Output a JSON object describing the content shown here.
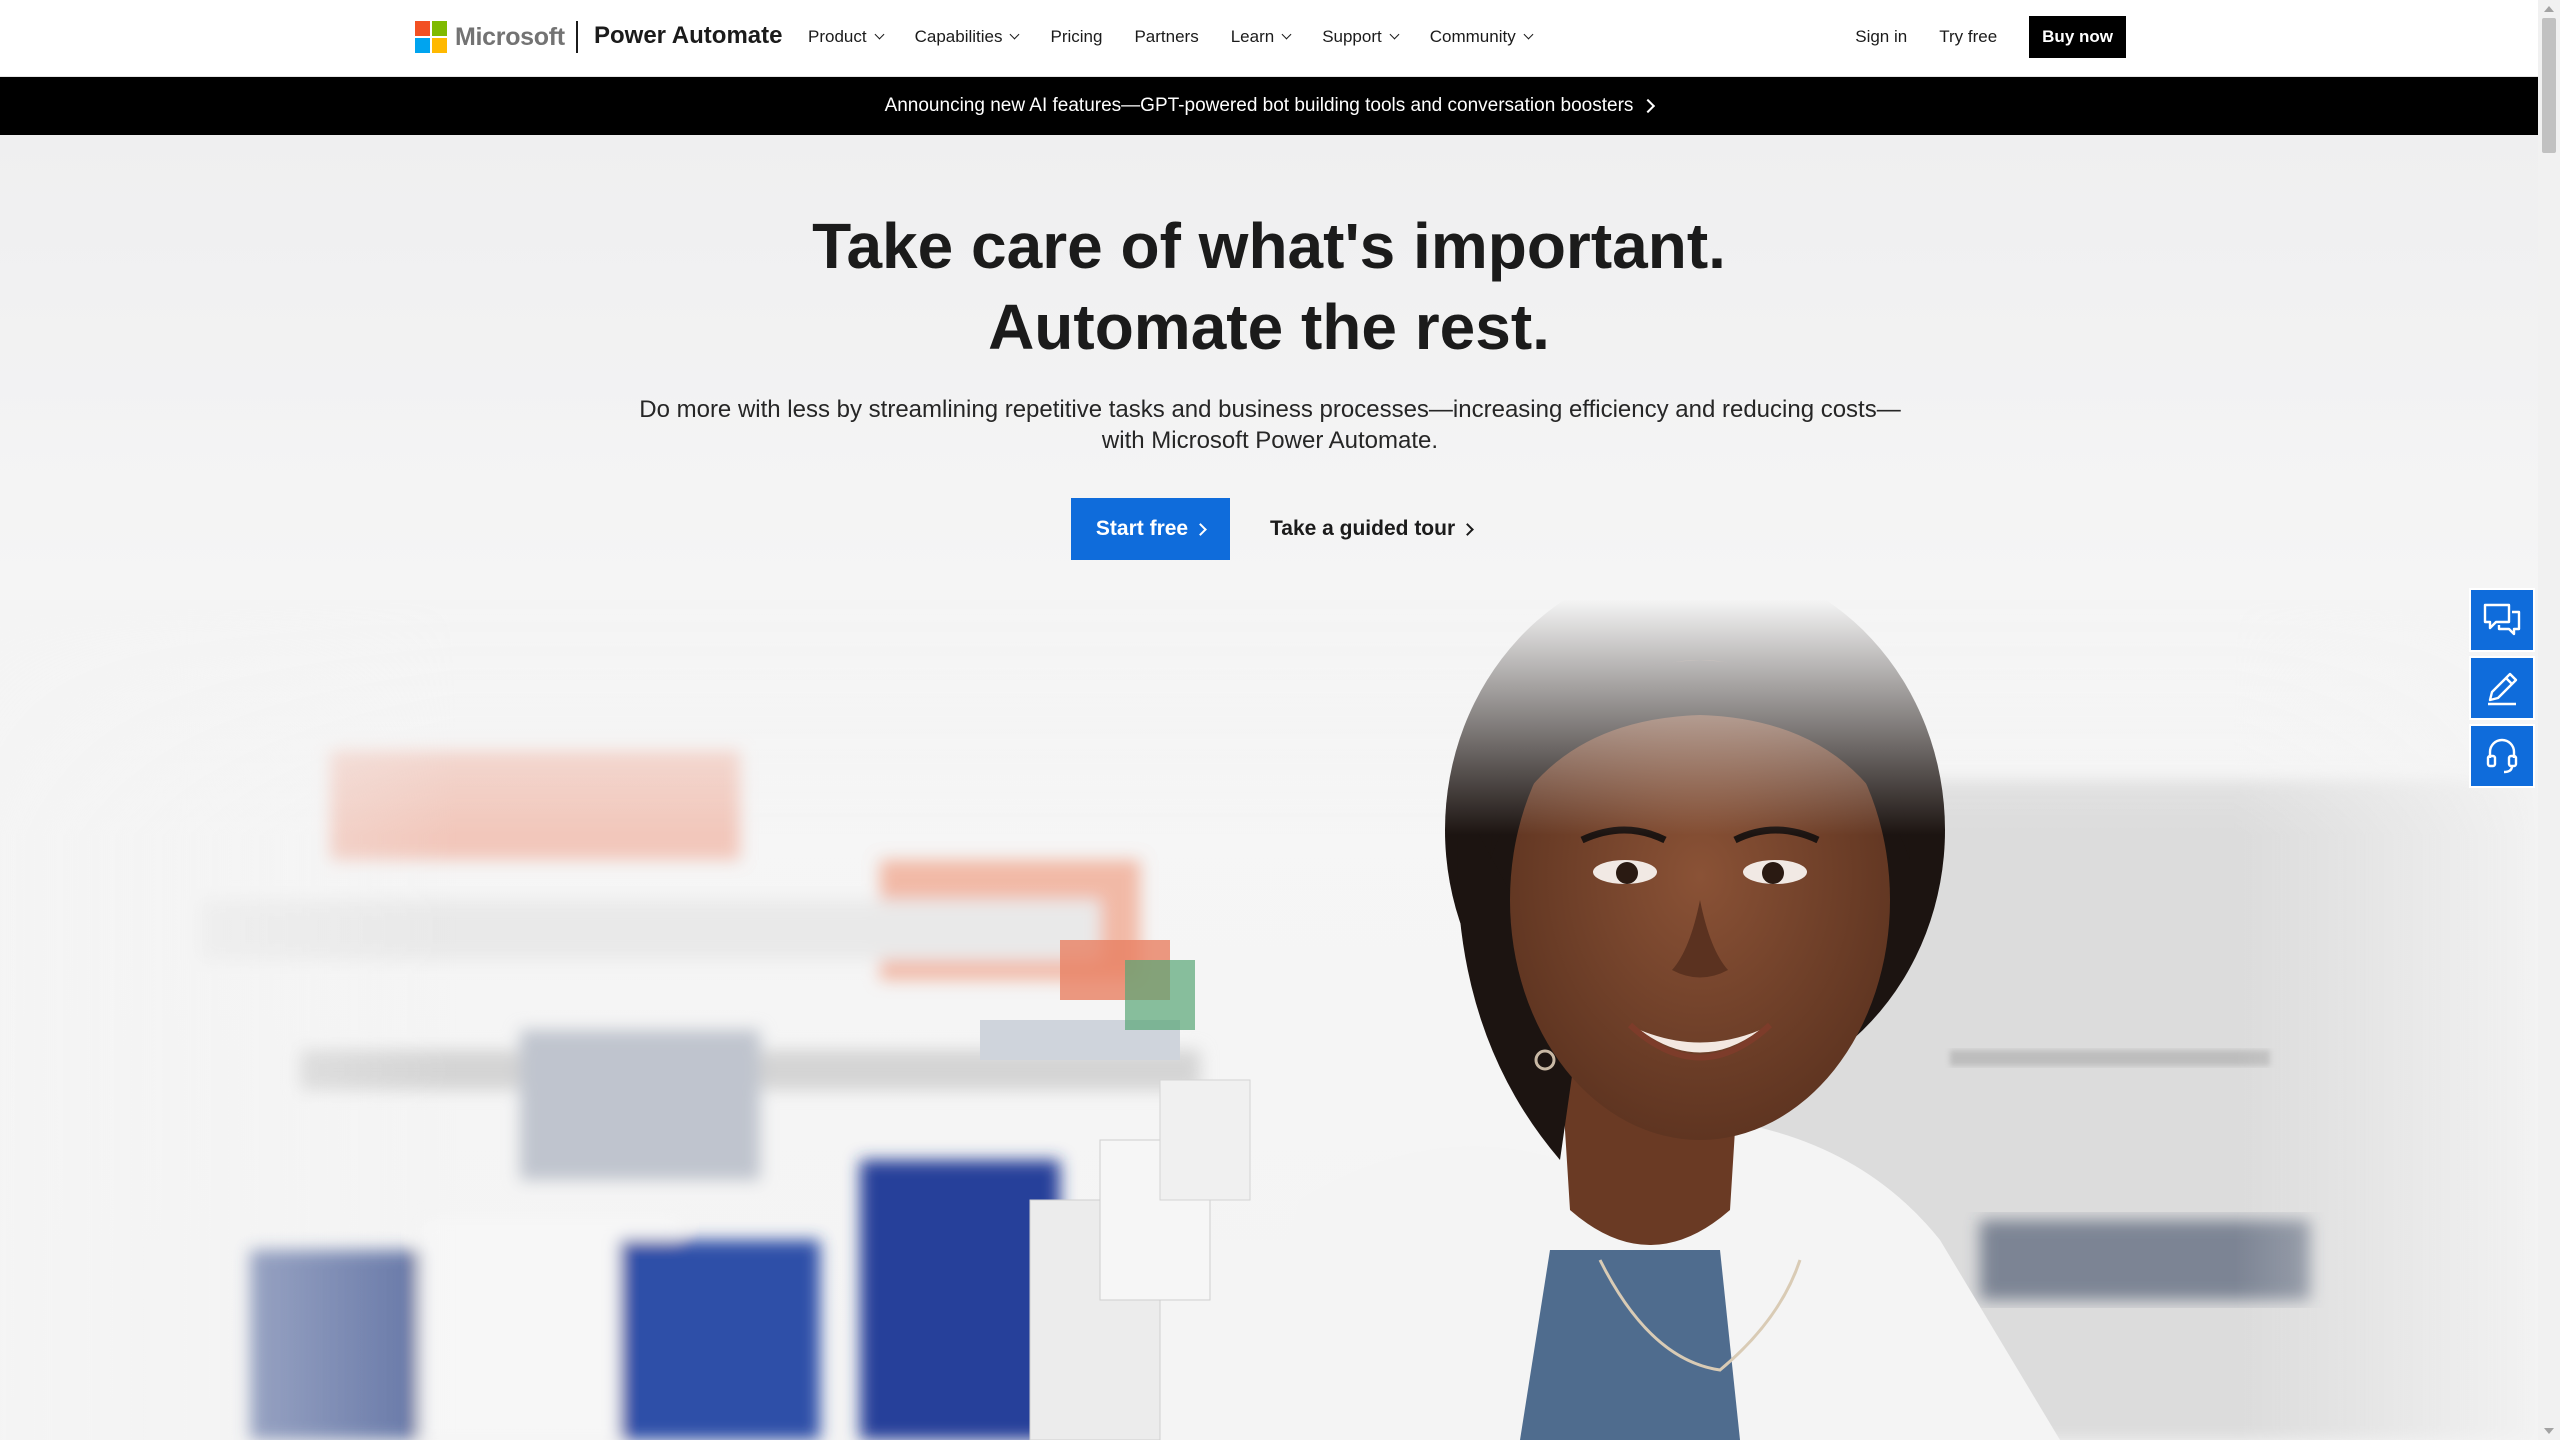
{
  "header": {
    "ms_logo_text": "Microsoft",
    "product_name": "Power Automate",
    "nav": [
      {
        "label": "Product",
        "has_dropdown": true
      },
      {
        "label": "Capabilities",
        "has_dropdown": true
      },
      {
        "label": "Pricing",
        "has_dropdown": false
      },
      {
        "label": "Partners",
        "has_dropdown": false
      },
      {
        "label": "Learn",
        "has_dropdown": true
      },
      {
        "label": "Support",
        "has_dropdown": true
      },
      {
        "label": "Community",
        "has_dropdown": true
      }
    ],
    "sign_in": "Sign in",
    "try_free": "Try free",
    "buy_now": "Buy now"
  },
  "banner": {
    "text": "Announcing new AI features—GPT-powered bot building tools and conversation boosters"
  },
  "hero": {
    "title_line1": "Take care of what's important.",
    "title_line2": "Automate the rest.",
    "subtitle": "Do more with less by streamlining repetitive tasks and business processes—increasing efficiency and reducing costs—with Microsoft Power Automate.",
    "primary_cta": "Start free",
    "secondary_cta": "Take a guided tour",
    "image_subject": "pharmacist-in-lab-coat"
  },
  "side_tools": [
    {
      "icon": "chat-icon"
    },
    {
      "icon": "pencil-icon"
    },
    {
      "icon": "headset-icon"
    }
  ],
  "colors": {
    "accent": "#0f6cdb",
    "banner_bg": "#000000",
    "text": "#1b1b1b",
    "ms_red": "#f25022",
    "ms_green": "#7fba00",
    "ms_blue": "#00a4ef",
    "ms_yellow": "#ffb900"
  }
}
